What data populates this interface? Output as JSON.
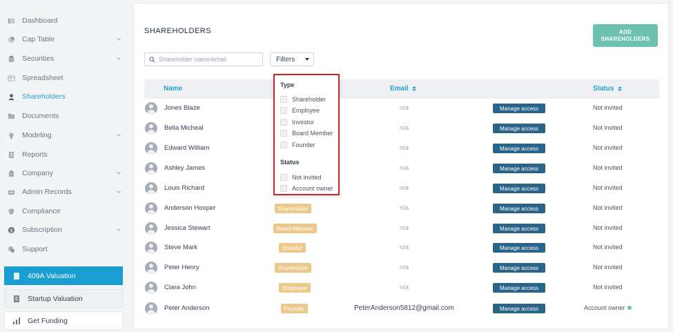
{
  "sidebar": {
    "items": [
      {
        "label": "Dashboard",
        "icon": "dashboard-icon",
        "has_chevron": false,
        "active": false
      },
      {
        "label": "Cap Table",
        "icon": "pie-chart-icon",
        "has_chevron": true,
        "active": false
      },
      {
        "label": "Securities",
        "icon": "clipboard-icon",
        "has_chevron": true,
        "active": false
      },
      {
        "label": "Spreadsheet",
        "icon": "spreadsheet-icon",
        "has_chevron": false,
        "active": false
      },
      {
        "label": "Shareholders",
        "icon": "user-icon",
        "has_chevron": false,
        "active": true
      },
      {
        "label": "Documents",
        "icon": "documents-icon",
        "has_chevron": false,
        "active": false
      },
      {
        "label": "Modeling",
        "icon": "lightbulb-icon",
        "has_chevron": true,
        "active": false
      },
      {
        "label": "Reports",
        "icon": "reports-icon",
        "has_chevron": false,
        "active": false
      },
      {
        "label": "Company",
        "icon": "company-icon",
        "has_chevron": true,
        "active": false
      },
      {
        "label": "Admin Records",
        "icon": "admin-records-icon",
        "has_chevron": true,
        "active": false
      },
      {
        "label": "Compliance",
        "icon": "shield-icon",
        "has_chevron": false,
        "active": false
      },
      {
        "label": "Subscription",
        "icon": "dollar-icon",
        "has_chevron": true,
        "active": false
      },
      {
        "label": "Support",
        "icon": "support-icon",
        "has_chevron": false,
        "active": false
      }
    ],
    "buttons": [
      {
        "label": "409A Valuation",
        "icon": "document-icon"
      },
      {
        "label": "Startup Valuation",
        "icon": "document-icon"
      },
      {
        "label": "Get Funding",
        "icon": "bar-chart-icon"
      }
    ]
  },
  "page": {
    "title": "SHAREHOLDERS",
    "add_button": "ADD SHAREHOLDERS",
    "search_placeholder": "Shareholder name/email",
    "filters_label": "Filters"
  },
  "table": {
    "columns": {
      "name": "Name",
      "email": "Email",
      "status": "Status"
    },
    "manage_label": "Manage access",
    "rows": [
      {
        "name": "Jones Blaze",
        "type": "",
        "email": "n/a",
        "status": "Not invited"
      },
      {
        "name": "Bella Micheal",
        "type": "",
        "email": "n/a",
        "status": "Not invited"
      },
      {
        "name": "Edward William",
        "type": "",
        "email": "n/a",
        "status": "Not invited"
      },
      {
        "name": "Ashley James",
        "type": "",
        "email": "n/a",
        "status": "Not invited"
      },
      {
        "name": "Louis Richard",
        "type": "",
        "email": "n/a",
        "status": "Not invited"
      },
      {
        "name": "Anderson Hooper",
        "type": "Shareholder",
        "email": "n/a",
        "status": "Not invited"
      },
      {
        "name": "Jessica Stewart",
        "type": "Board Member",
        "email": "n/a",
        "status": "Not invited"
      },
      {
        "name": "Steve Mark",
        "type": "Investor",
        "email": "n/a",
        "status": "Not invited"
      },
      {
        "name": "Peter Henry",
        "type": "Shareholder",
        "email": "n/a",
        "status": "Not invited"
      },
      {
        "name": "Clara John",
        "type": "Employee",
        "email": "n/a",
        "status": "Not invited"
      },
      {
        "name": "Peter Anderson",
        "type": "Founder",
        "email": "PeterAnderson5812@gmail.com",
        "status": "Account owner"
      }
    ]
  },
  "filter_dropdown": {
    "type_heading": "Type",
    "type_options": [
      "Shareholder",
      "Employee",
      "Investor",
      "Board Member",
      "Founder"
    ],
    "status_heading": "Status",
    "status_options": [
      "Not invited",
      "Account owner"
    ]
  },
  "colors": {
    "accent": "#2a9fc9",
    "add_button": "#6cc2ad",
    "type_badge": "#ecc98b",
    "manage_button": "#2b6489",
    "dropdown_border": "#c8242a",
    "primary_sidebar_button": "#1a9dd0"
  }
}
